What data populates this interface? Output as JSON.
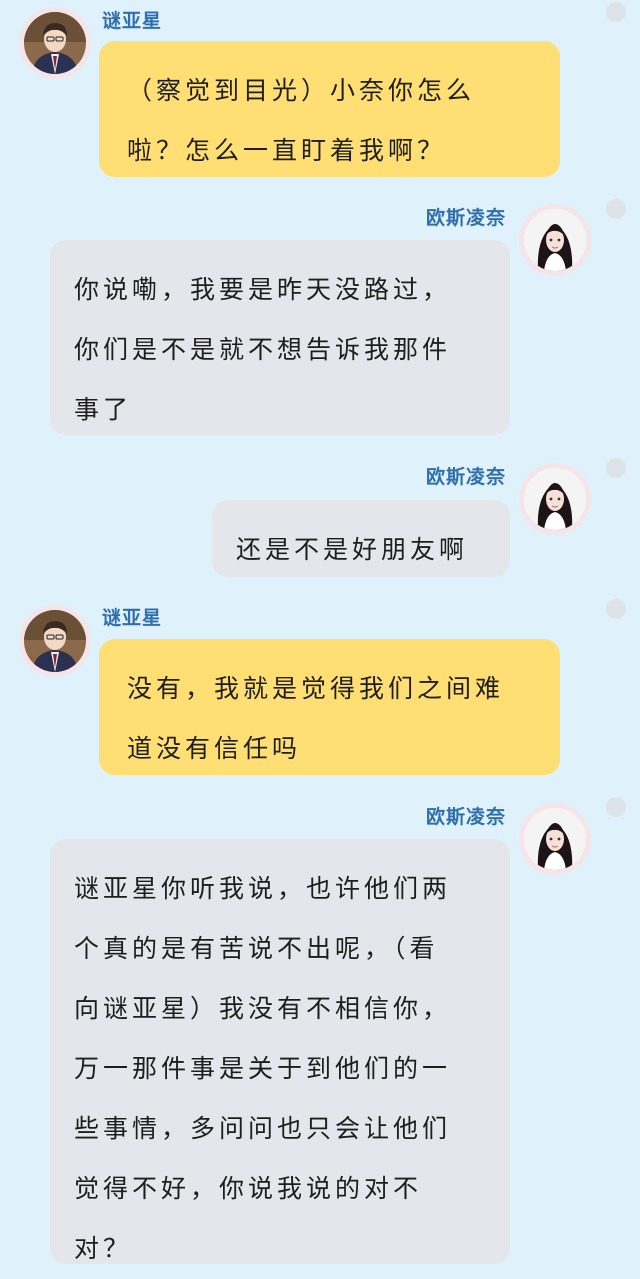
{
  "colors": {
    "background": "#dff1fb",
    "yellow_bubble": "#ffde73",
    "gray_bubble": "#e4e6eb",
    "name_text": "#2f6fae",
    "dot": "#dde3e8"
  },
  "messages": [
    {
      "sender": "谜亚星",
      "avatar_icon": "boy-avatar-icon",
      "text": "（察觉到目光）小奈你怎么\n啦？怎么一直盯着我啊？"
    },
    {
      "sender": "欧斯凌奈",
      "avatar_icon": "girl-avatar-icon",
      "text": "你说嘞，我要是昨天没路过，\n你们是不是就不想告诉我那件\n事了"
    },
    {
      "sender": "欧斯凌奈",
      "avatar_icon": "girl-avatar-icon",
      "text": "还是不是好朋友啊"
    },
    {
      "sender": "谜亚星",
      "avatar_icon": "boy-avatar-icon",
      "text": "没有，我就是觉得我们之间难\n道没有信任吗"
    },
    {
      "sender": "欧斯凌奈",
      "avatar_icon": "girl-avatar-icon",
      "text": "谜亚星你听我说，也许他们两\n个真的是有苦说不出呢，（看\n向谜亚星）我没有不相信你，\n万一那件事是关于到他们的一\n些事情，多问问也只会让他们\n觉得不好，你说我说的对不\n对？"
    }
  ]
}
